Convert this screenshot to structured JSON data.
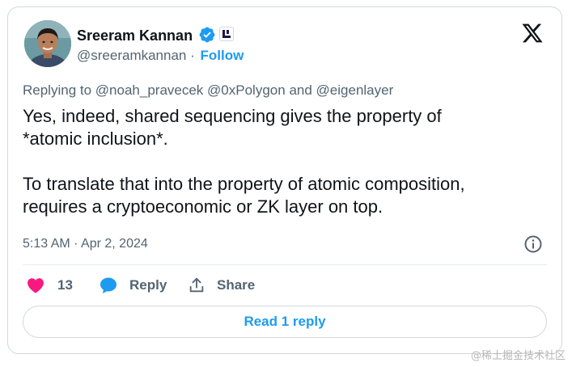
{
  "author": {
    "name": "Sreeram Kannan",
    "handle": "@sreeramkannan",
    "separator": "·",
    "follow_label": "Follow"
  },
  "reply_context": {
    "prefix": "Replying to",
    "mention_1": "@noah_pravecek",
    "mention_2": "@0xPolygon",
    "conjunction": "and",
    "mention_3": "@eigenlayer"
  },
  "tweet": {
    "line_1": "Yes, indeed, shared sequencing gives the property of",
    "line_2": "*atomic inclusion*.",
    "line_3": "To translate that into the property of atomic composition,",
    "line_4": "requires a cryptoeconomic or ZK layer on top.",
    "timestamp": "5:13 AM · Apr 2, 2024"
  },
  "actions": {
    "like_count": "13",
    "reply_label": "Reply",
    "share_label": "Share"
  },
  "read_reply_label": "Read 1 reply",
  "watermark": "@稀土掘金技术社区",
  "icons": {
    "verified": "verified-badge-icon",
    "affiliate": "affiliate-badge-icon",
    "platform": "x-logo-icon",
    "info": "info-icon",
    "like": "heart-icon",
    "reply": "speech-bubble-icon",
    "share": "share-upload-icon"
  },
  "colors": {
    "accent": "#1d9bf0",
    "like": "#f91880",
    "text_primary": "#0f1419",
    "text_secondary": "#536471",
    "border": "#cfd9de"
  }
}
